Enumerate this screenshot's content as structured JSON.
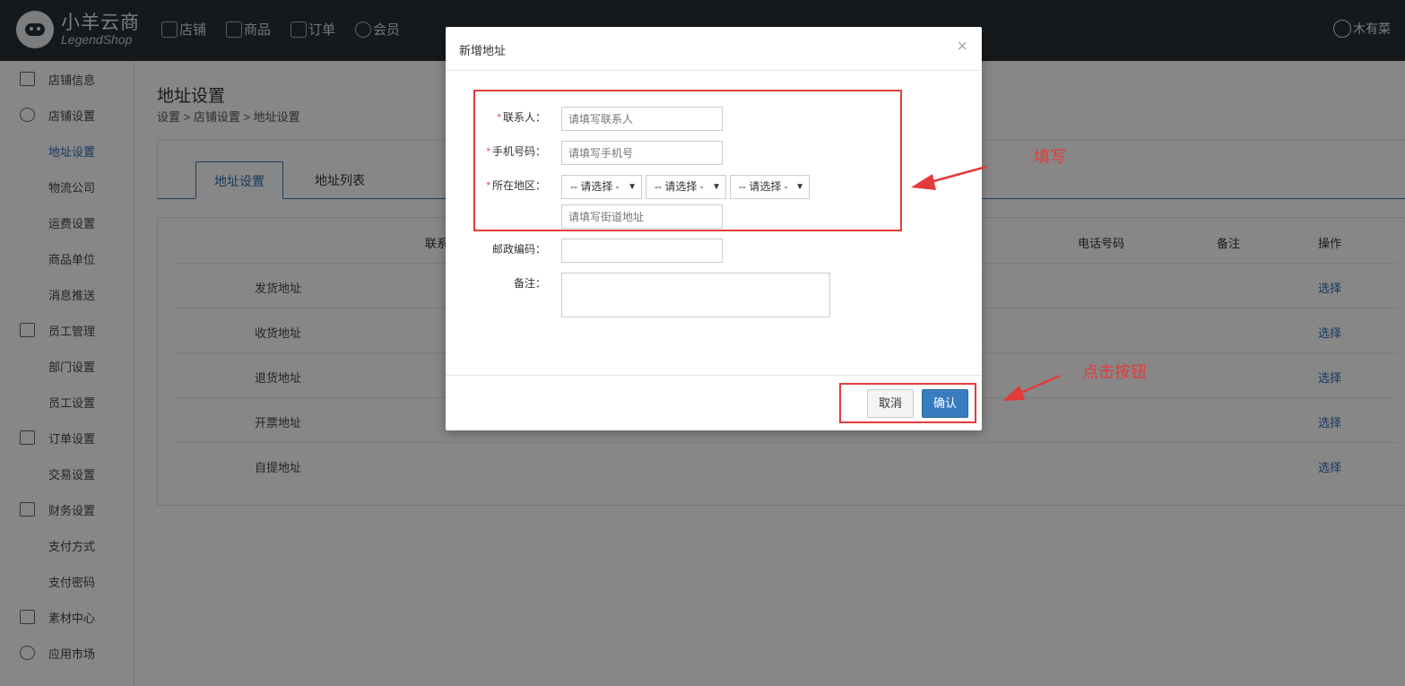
{
  "header": {
    "logo_cn": "小羊云商",
    "logo_en": "LegendShop",
    "nav": [
      {
        "label": "店铺",
        "icon": "home-icon"
      },
      {
        "label": "商品",
        "icon": "bag-icon"
      },
      {
        "label": "订单",
        "icon": "order-icon"
      },
      {
        "label": "会员",
        "icon": "user-icon"
      }
    ],
    "user_name": "木有菜"
  },
  "sidebar": {
    "items": [
      {
        "label": "店铺信息",
        "icon": "store-icon",
        "group": true
      },
      {
        "label": "店铺设置",
        "icon": "gear-icon",
        "group": true
      },
      {
        "label": "地址设置",
        "active": true
      },
      {
        "label": "物流公司"
      },
      {
        "label": "运费设置"
      },
      {
        "label": "商品单位"
      },
      {
        "label": "消息推送"
      },
      {
        "label": "员工管理",
        "icon": "staff-icon",
        "group": true
      },
      {
        "label": "部门设置"
      },
      {
        "label": "员工设置"
      },
      {
        "label": "订单设置",
        "icon": "order-icon",
        "group": true
      },
      {
        "label": "交易设置"
      },
      {
        "label": "财务设置",
        "icon": "finance-icon",
        "group": true
      },
      {
        "label": "支付方式"
      },
      {
        "label": "支付密码"
      },
      {
        "label": "素材中心",
        "icon": "layers-icon",
        "group": true
      },
      {
        "label": "应用市场",
        "icon": "apps-icon",
        "group": true
      }
    ]
  },
  "main": {
    "title": "地址设置",
    "breadcrumb": "设置 > 店铺设置 > 地址设置",
    "tabs": [
      {
        "label": "地址设置"
      },
      {
        "label": "地址列表"
      }
    ],
    "table": {
      "headers": [
        "联系",
        "电话号码",
        "备注",
        "操作"
      ],
      "rows": [
        {
          "name": "发货地址",
          "action": "选择"
        },
        {
          "name": "收货地址",
          "action": "选择"
        },
        {
          "name": "退货地址",
          "action": "选择"
        },
        {
          "name": "开票地址",
          "action": "选择"
        },
        {
          "name": "自提地址",
          "action": "选择"
        }
      ]
    }
  },
  "modal": {
    "title": "新增地址",
    "close": "×",
    "req_mark": "*",
    "contact_label": "联系人：",
    "contact_placeholder": "请填写联系人",
    "phone_label": "手机号码：",
    "phone_placeholder": "请填写手机号",
    "region_label": "所在地区：",
    "region_selects": [
      "-- 请选择 -",
      "-- 请选择 -",
      "-- 请选择 -"
    ],
    "street_placeholder": "请填写街道地址",
    "zip_label": "邮政编码：",
    "remark_label": "备注：",
    "cancel": "取消",
    "confirm": "确认"
  },
  "annotations": {
    "fill_note": "填写",
    "click_note": "点击按钮",
    "color": "#e33b3b"
  }
}
